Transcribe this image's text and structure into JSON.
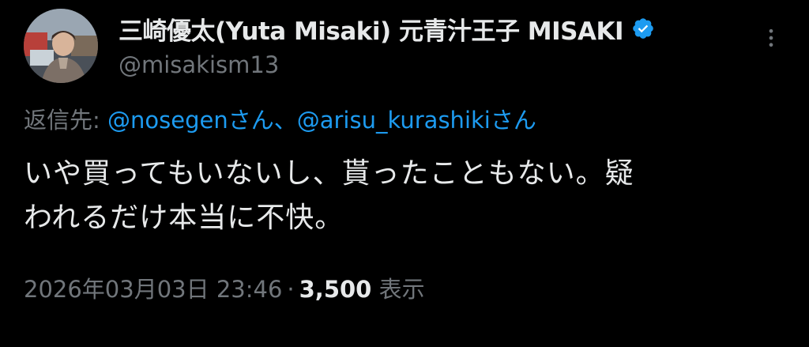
{
  "tweet": {
    "author": {
      "display_name": "三崎優太(Yuta Misaki) 元青汁王子 MISAKI",
      "handle": "@misakism13",
      "verified": true,
      "verified_icon": "verified-badge-icon",
      "avatar_icon": "avatar-photo"
    },
    "more_icon": "more-options-icon",
    "reply_to": {
      "prefix": "返信先: ",
      "mentions": [
        {
          "handle": "@nosegen",
          "suffix": "さん"
        },
        {
          "handle": "@arisu_kurashiki",
          "suffix": "さん"
        }
      ],
      "separator": "、"
    },
    "text_line_1": "いや買ってもいないし、貰ったこともない。疑",
    "text_line_2": "われるだけ本当に不快。",
    "timestamp": "2026年03月03日 23:46",
    "dot": "·",
    "views_count": "3,500",
    "views_label": " 表示"
  },
  "colors": {
    "background": "#000000",
    "primary_text": "#e7e9ea",
    "secondary_text": "#71767b",
    "link": "#1d9bf0"
  }
}
